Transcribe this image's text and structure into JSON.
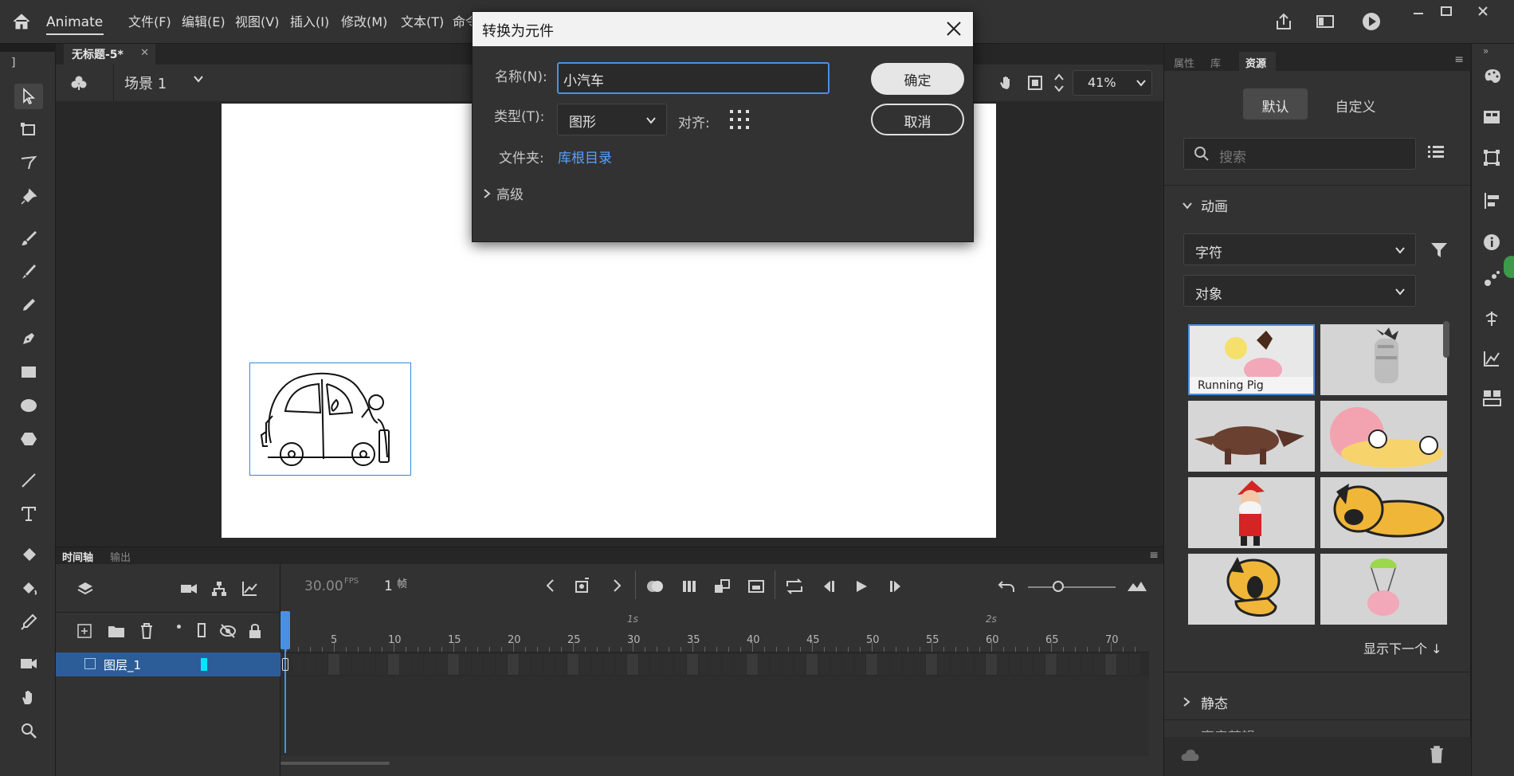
{
  "app": {
    "name": "Animate"
  },
  "menu": [
    "文件(F)",
    "编辑(E)",
    "视图(V)",
    "插入(I)",
    "修改(M)",
    "文本(T)",
    "命令"
  ],
  "document": {
    "tab_title": "无标题-5*",
    "scene": "场景 1",
    "zoom": "41%"
  },
  "timeline": {
    "tabs": [
      "时间轴",
      "输出"
    ],
    "fps": "30.00",
    "fps_unit": "FPS",
    "frame": "1",
    "frame_unit": "帧",
    "layer_name": "图层_1",
    "ruler": [
      "5",
      "10",
      "15",
      "20",
      "25",
      "30",
      "35",
      "40",
      "45",
      "50",
      "55",
      "60",
      "65",
      "70"
    ],
    "seconds": [
      "1s",
      "2s"
    ]
  },
  "panel": {
    "tabs": [
      "属性",
      "库",
      "资源"
    ],
    "toggle": [
      "默认",
      "自定义"
    ],
    "search_placeholder": "搜索",
    "section_anim": "动画",
    "dropdown1": "字符",
    "dropdown2": "对象",
    "first_thumb_label": "Running Pig",
    "show_more": "显示下一个 ↓",
    "section_static": "静态",
    "section_cut": "声音剪辑"
  },
  "dialog": {
    "title": "转换为元件",
    "name_label": "名称(N):",
    "name_value": "小汽车",
    "type_label": "类型(T):",
    "type_value": "图形",
    "align_label": "对齐:",
    "folder_label": "文件夹:",
    "folder_value": "库根目录",
    "advanced": "高级",
    "ok": "确定",
    "cancel": "取消"
  },
  "colors": {
    "accent": "#3a87d8",
    "selection_row": "#2c5d99",
    "playhead": "#4a90e2",
    "link": "#5aa0ff"
  }
}
